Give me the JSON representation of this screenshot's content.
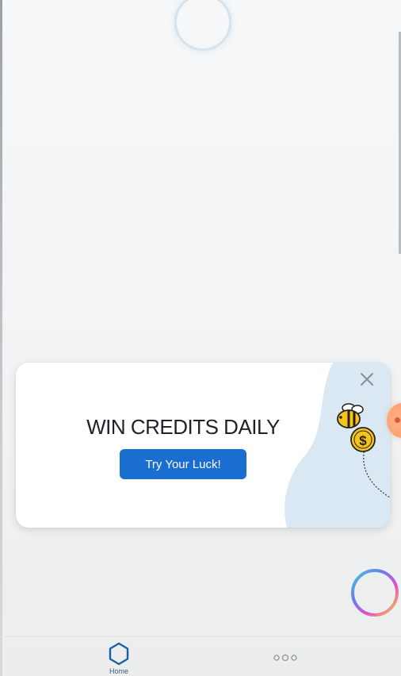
{
  "promo": {
    "title": "WIN CREDITS DAILY",
    "cta_label": "Try Your Luck!",
    "close_symbol": "✕",
    "illustration": "bee-carrying-dollar-coin",
    "coin_symbol": "$"
  },
  "navigation": {
    "home_label": "Home",
    "home_icon": "hexagon-icon",
    "more_icon": "more-dots-icon"
  },
  "colors": {
    "accent": "#1a6ed0",
    "nav_icon": "#1b5fa8",
    "blob": "#d9e8f3"
  }
}
